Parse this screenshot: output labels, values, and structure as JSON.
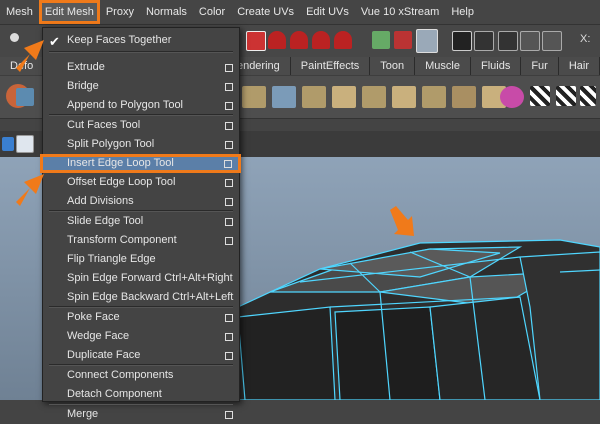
{
  "menubar": {
    "items": [
      "Mesh",
      "Edit Mesh",
      "Proxy",
      "Normals",
      "Color",
      "Create UVs",
      "Edit UVs",
      "Vue 10 xStream",
      "Help"
    ],
    "active_index": 1
  },
  "shelf_tabs": [
    "Defo",
    "endering",
    "PaintEffects",
    "Toon",
    "Muscle",
    "Fluids",
    "Fur",
    "Hair"
  ],
  "toolbar_right_label": "X:",
  "menu": {
    "keep_faces": "Keep Faces Together",
    "items": [
      {
        "label": "Extrude",
        "option": true
      },
      {
        "label": "Bridge",
        "option": true
      },
      {
        "label": "Append to Polygon Tool",
        "option": true
      },
      {
        "label": "Cut Faces Tool",
        "option": true
      },
      {
        "label": "Split Polygon Tool",
        "option": true
      },
      {
        "label": "Insert Edge Loop Tool",
        "option": true,
        "highlighted": true
      },
      {
        "label": "Offset Edge Loop Tool",
        "option": true
      },
      {
        "label": "Add Divisions",
        "option": true
      },
      {
        "label": "Slide Edge Tool",
        "option": true
      },
      {
        "label": "Transform Component",
        "option": true
      },
      {
        "label": "Flip Triangle Edge",
        "option": false
      },
      {
        "label": "Spin Edge Forward",
        "shortcut": "Ctrl+Alt+Right",
        "option": false
      },
      {
        "label": "Spin Edge Backward",
        "shortcut": "Ctrl+Alt+Left",
        "option": false
      },
      {
        "label": "Poke Face",
        "option": true
      },
      {
        "label": "Wedge Face",
        "option": true
      },
      {
        "label": "Duplicate Face",
        "option": true
      },
      {
        "label": "Connect Components",
        "option": false
      },
      {
        "label": "Detach Component",
        "option": false
      },
      {
        "label": "Merge",
        "option": true
      }
    ]
  },
  "colors": {
    "highlight_outline": "#f07a1a",
    "menu_bg": "#444444",
    "selection_bg": "#5b7fa8",
    "wire": "#4fd6ff"
  }
}
